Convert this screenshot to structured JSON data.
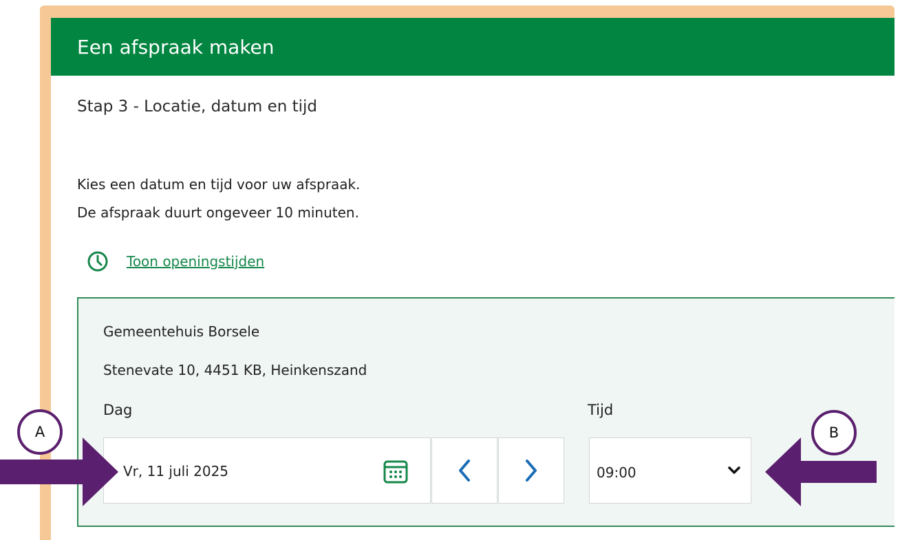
{
  "header": {
    "title": "Een afspraak maken"
  },
  "step": {
    "title": "Stap 3 - Locatie, datum en tijd"
  },
  "intro": {
    "line1": "Kies een datum en tijd voor uw afspraak.",
    "line2": "De afspraak duurt ongeveer 10 minuten."
  },
  "opening_hours": {
    "link_label": "Toon openingstijden",
    "icon": "clock-icon"
  },
  "location": {
    "name": "Gemeentehuis Borsele",
    "address": "Stenevate 10, 4451 KB, Heinkenszand",
    "day_label": "Dag",
    "time_label": "Tijd",
    "date_value": "Vr, 11 juli 2025",
    "time_value": "09:00"
  },
  "annotations": {
    "marker_a": "A",
    "marker_b": "B"
  },
  "colors": {
    "header_green": "#018540",
    "link_green": "#15874a",
    "accent_blue": "#1a6db5",
    "frame_orange": "#f5c896",
    "annotation_purple": "#5a1f6e"
  }
}
